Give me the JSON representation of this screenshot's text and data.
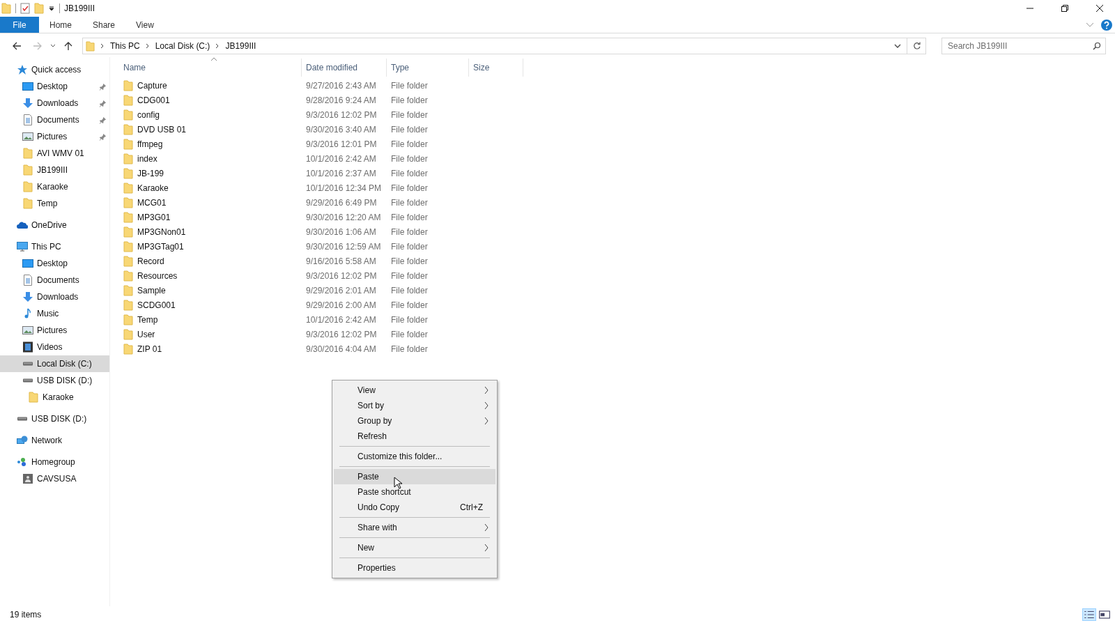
{
  "window": {
    "title": "JB199III"
  },
  "ribbon_tabs": [
    {
      "label": "File",
      "selected": true
    },
    {
      "label": "Home",
      "selected": false
    },
    {
      "label": "Share",
      "selected": false
    },
    {
      "label": "View",
      "selected": false
    }
  ],
  "address": {
    "crumbs": [
      "This PC",
      "Local Disk (C:)",
      "JB199III"
    ]
  },
  "search": {
    "placeholder": "Search JB199III"
  },
  "sidebar": {
    "items": [
      {
        "label": "Quick access",
        "kind": "star",
        "selected": false,
        "children": [
          {
            "label": "Desktop",
            "kind": "desktop",
            "pinned": true,
            "selected": false
          },
          {
            "label": "Downloads",
            "kind": "download",
            "pinned": true,
            "selected": false
          },
          {
            "label": "Documents",
            "kind": "documents",
            "pinned": true,
            "selected": false
          },
          {
            "label": "Pictures",
            "kind": "pictures",
            "pinned": true,
            "selected": false
          },
          {
            "label": "AVI WMV 01",
            "kind": "folder",
            "pinned": false,
            "selected": false
          },
          {
            "label": "JB199III",
            "kind": "folder",
            "pinned": false,
            "selected": false
          },
          {
            "label": "Karaoke",
            "kind": "folder",
            "pinned": false,
            "selected": false
          },
          {
            "label": "Temp",
            "kind": "folder",
            "pinned": false,
            "selected": false
          }
        ]
      },
      {
        "label": "OneDrive",
        "kind": "cloud",
        "selected": false
      },
      {
        "label": "This PC",
        "kind": "pc",
        "selected": false,
        "children": [
          {
            "label": "Desktop",
            "kind": "desktop",
            "selected": false
          },
          {
            "label": "Documents",
            "kind": "documents",
            "selected": false
          },
          {
            "label": "Downloads",
            "kind": "download",
            "selected": false
          },
          {
            "label": "Music",
            "kind": "music",
            "selected": false
          },
          {
            "label": "Pictures",
            "kind": "pictures",
            "selected": false
          },
          {
            "label": "Videos",
            "kind": "videos",
            "selected": false
          },
          {
            "label": "Local Disk (C:)",
            "kind": "drive",
            "selected": true
          },
          {
            "label": "USB DISK (D:)",
            "kind": "drive",
            "selected": false,
            "children": [
              {
                "label": "Karaoke",
                "kind": "folder",
                "selected": false
              }
            ]
          }
        ]
      },
      {
        "label": "USB DISK (D:)",
        "kind": "drive",
        "selected": false
      },
      {
        "label": "Network",
        "kind": "network",
        "selected": false
      },
      {
        "label": "Homegroup",
        "kind": "homegroup",
        "selected": false,
        "children": [
          {
            "label": "CAVSUSA",
            "kind": "user",
            "selected": false
          }
        ]
      }
    ]
  },
  "table": {
    "columns": [
      "Name",
      "Date modified",
      "Type",
      "Size"
    ],
    "rows": [
      {
        "name": "Capture",
        "date": "9/27/2016 2:43 AM",
        "type": "File folder"
      },
      {
        "name": "CDG001",
        "date": "9/28/2016 9:24 AM",
        "type": "File folder"
      },
      {
        "name": "config",
        "date": "9/3/2016 12:02 PM",
        "type": "File folder"
      },
      {
        "name": "DVD USB 01",
        "date": "9/30/2016 3:40 AM",
        "type": "File folder"
      },
      {
        "name": "ffmpeg",
        "date": "9/3/2016 12:01 PM",
        "type": "File folder"
      },
      {
        "name": "index",
        "date": "10/1/2016 2:42 AM",
        "type": "File folder"
      },
      {
        "name": "JB-199",
        "date": "10/1/2016 2:37 AM",
        "type": "File folder"
      },
      {
        "name": "Karaoke",
        "date": "10/1/2016 12:34 PM",
        "type": "File folder"
      },
      {
        "name": "MCG01",
        "date": "9/29/2016 6:49 PM",
        "type": "File folder"
      },
      {
        "name": "MP3G01",
        "date": "9/30/2016 12:20 AM",
        "type": "File folder"
      },
      {
        "name": "MP3GNon01",
        "date": "9/30/2016 1:06 AM",
        "type": "File folder"
      },
      {
        "name": "MP3GTag01",
        "date": "9/30/2016 12:59 AM",
        "type": "File folder"
      },
      {
        "name": "Record",
        "date": "9/16/2016 5:58 AM",
        "type": "File folder"
      },
      {
        "name": "Resources",
        "date": "9/3/2016 12:02 PM",
        "type": "File folder"
      },
      {
        "name": "Sample",
        "date": "9/29/2016 2:01 AM",
        "type": "File folder"
      },
      {
        "name": "SCDG001",
        "date": "9/29/2016 2:00 AM",
        "type": "File folder"
      },
      {
        "name": "Temp",
        "date": "10/1/2016 2:42 AM",
        "type": "File folder"
      },
      {
        "name": "User",
        "date": "9/3/2016 12:02 PM",
        "type": "File folder"
      },
      {
        "name": "ZIP 01",
        "date": "9/30/2016 4:04 AM",
        "type": "File folder"
      }
    ]
  },
  "context_menu": {
    "items": [
      {
        "label": "View",
        "submenu": true,
        "selected": false,
        "separator_after": false
      },
      {
        "label": "Sort by",
        "submenu": true,
        "selected": false,
        "separator_after": false
      },
      {
        "label": "Group by",
        "submenu": true,
        "selected": false,
        "separator_after": false
      },
      {
        "label": "Refresh",
        "submenu": false,
        "selected": false,
        "separator_after": true
      },
      {
        "label": "Customize this folder...",
        "submenu": false,
        "selected": false,
        "separator_after": true
      },
      {
        "label": "Paste",
        "submenu": false,
        "selected": true,
        "separator_after": false
      },
      {
        "label": "Paste shortcut",
        "submenu": false,
        "selected": false,
        "separator_after": false
      },
      {
        "label": "Undo Copy",
        "shortcut": "Ctrl+Z",
        "submenu": false,
        "selected": false,
        "separator_after": true
      },
      {
        "label": "Share with",
        "submenu": true,
        "selected": false,
        "separator_after": true
      },
      {
        "label": "New",
        "submenu": true,
        "selected": false,
        "separator_after": true
      },
      {
        "label": "Properties",
        "submenu": false,
        "selected": false,
        "separator_after": false
      }
    ]
  },
  "status_bar": {
    "item_count": "19 items"
  }
}
